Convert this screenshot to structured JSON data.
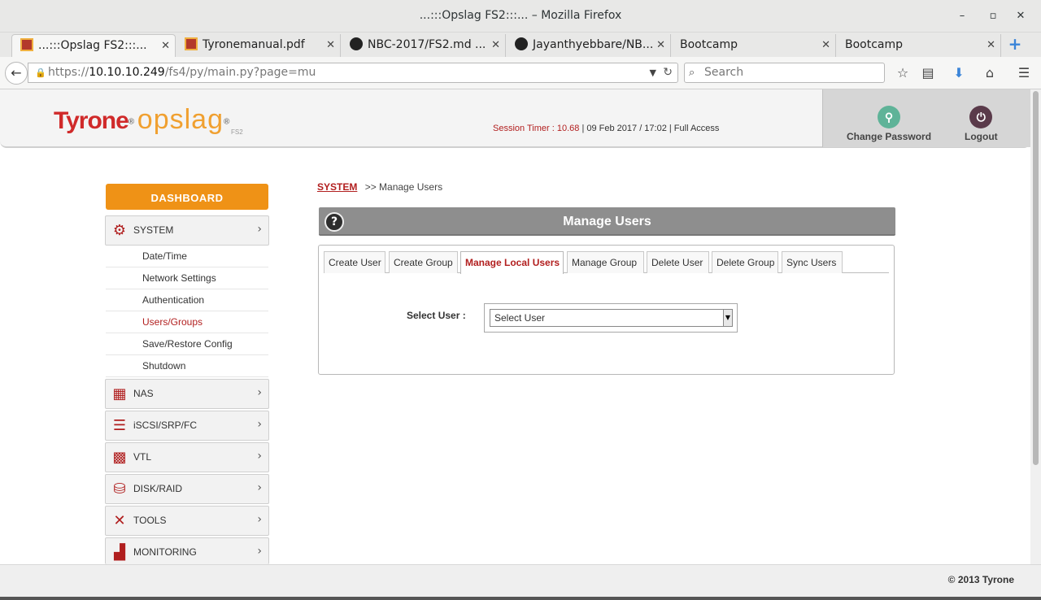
{
  "window": {
    "title": "...:::Opslag FS2:::... – Mozilla Firefox",
    "minimize": "–",
    "maximize": "▫",
    "close": "✕"
  },
  "tabs": [
    {
      "label": "...:::Opslag FS2:::...",
      "icon": "document-icon",
      "active": true
    },
    {
      "label": "Tyronemanual.pdf",
      "icon": "document-icon",
      "active": false
    },
    {
      "label": "NBC-2017/FS2.md ...",
      "icon": "github-icon",
      "active": false
    },
    {
      "label": "Jayanthyebbare/NB...",
      "icon": "github-icon",
      "active": false
    },
    {
      "label": "Bootcamp",
      "icon": "",
      "active": false
    },
    {
      "label": "Bootcamp",
      "icon": "",
      "active": false
    }
  ],
  "tab_close": "✕",
  "new_tab": "+",
  "navbar": {
    "url_prefix": "https://",
    "url_host": "10.10.10.249",
    "url_path": "/fs4/py/main.py?page=mu",
    "search_placeholder": "Search"
  },
  "header": {
    "logo_brand": "Tyrone",
    "logo_product": "opslag",
    "logo_sub": "FS2",
    "logo_mark": "®",
    "session_label": "Session Timer : 10.68",
    "session_rest": " | 09 Feb 2017 / 17:02 | Full Access",
    "change_password": "Change Password",
    "logout": "Logout"
  },
  "sidebar": {
    "dashboard": "DASHBOARD",
    "system": "SYSTEM",
    "system_items": [
      {
        "label": "Date/Time",
        "selected": false
      },
      {
        "label": "Network Settings",
        "selected": false
      },
      {
        "label": "Authentication",
        "selected": false
      },
      {
        "label": "Users/Groups",
        "selected": true
      },
      {
        "label": "Save/Restore Config",
        "selected": false
      },
      {
        "label": "Shutdown",
        "selected": false
      }
    ],
    "menus": [
      {
        "label": "NAS",
        "icon": "nas-icon"
      },
      {
        "label": "iSCSI/SRP/FC",
        "icon": "iscsi-icon"
      },
      {
        "label": "VTL",
        "icon": "vtl-icon"
      },
      {
        "label": "DISK/RAID",
        "icon": "disk-icon"
      },
      {
        "label": "TOOLS",
        "icon": "tools-icon"
      },
      {
        "label": "MONITORING",
        "icon": "monitoring-icon"
      }
    ]
  },
  "breadcrumb": {
    "root": "SYSTEM",
    "current": ">> Manage Users"
  },
  "panel": {
    "title": "Manage Users",
    "help": "?",
    "tabs": [
      {
        "label": "Create User",
        "active": false
      },
      {
        "label": "Create Group",
        "active": false
      },
      {
        "label": "Manage Local Users",
        "active": true
      },
      {
        "label": "Manage Group",
        "active": false
      },
      {
        "label": "Delete User",
        "active": false
      },
      {
        "label": "Delete Group",
        "active": false
      },
      {
        "label": "Sync Users",
        "active": false
      }
    ],
    "select_label": "Select User :",
    "select_value": "Select User"
  },
  "footer": {
    "copyright": "© 2013 Tyrone"
  },
  "colors": {
    "brand_red": "#b21f1f",
    "dashboard_orange": "#ef9216",
    "panel_gray": "#8e8e8e"
  }
}
